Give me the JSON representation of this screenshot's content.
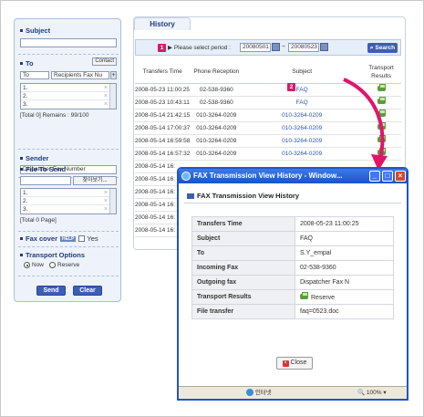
{
  "left_panel": {
    "subject_label": "Subject",
    "to_label": "To",
    "contact_button": "Contact",
    "to_type_value": "To",
    "recipients_fax_placeholder": "Recipients Fax Nu",
    "recipient_rows": [
      "1.",
      "2.",
      "3."
    ],
    "to_total": "[Total 0] Remains : 99/100",
    "sender_label": "Sender",
    "sender_value": "Dispatcher Fax Number",
    "file_label": "File To Send",
    "browse_button": "찾아보기...",
    "file_rows": [
      "1.",
      "2.",
      "3."
    ],
    "file_total": "[Total 0 Page]",
    "fax_cover_label": "Fax cover",
    "help_label": "HELP",
    "fax_cover_yes": "Yes",
    "transport_label": "Transport Options",
    "transport_now": "Now",
    "transport_reserve": "Reserve",
    "send_button": "Send",
    "clear_button": "Clear"
  },
  "history": {
    "tab_label": "History",
    "badge1": "1",
    "period_label": "Please select period :",
    "date_from": "20080501",
    "date_sep": "~",
    "date_to": "20080523",
    "search_button": "Search",
    "badge2": "2",
    "columns": [
      "Transfers Time",
      "Phone Reception",
      "Subject",
      "Transport Results"
    ],
    "rows": [
      {
        "time": "2008-05-23 11:00:25",
        "phone": "02-538-9360",
        "subject": "FAQ"
      },
      {
        "time": "2008-05-23 10:43:11",
        "phone": "02-538-9360",
        "subject": "FAQ"
      },
      {
        "time": "2008-05-14 21:42:15",
        "phone": "010-3264-0209",
        "subject": "010-3264-0209"
      },
      {
        "time": "2008-05-14 17:00:37",
        "phone": "010-3264-0209",
        "subject": "010-3264-0209"
      },
      {
        "time": "2008-05-14 16:59:58",
        "phone": "010-3264-0209",
        "subject": "010-3264-0209"
      },
      {
        "time": "2008-05-14 16:57:32",
        "phone": "010-3264-0209",
        "subject": "010-3264-0209"
      },
      {
        "time": "2008-05-14 16:",
        "phone": "",
        "subject": ""
      },
      {
        "time": "2008-05-14 16:",
        "phone": "",
        "subject": ""
      },
      {
        "time": "2008-05-14 16:",
        "phone": "",
        "subject": ""
      },
      {
        "time": "2008-05-14 16:",
        "phone": "",
        "subject": ""
      },
      {
        "time": "2008-05-14 16:",
        "phone": "",
        "subject": ""
      },
      {
        "time": "2008-05-14 16:",
        "phone": "",
        "subject": ""
      }
    ]
  },
  "popup": {
    "window_title": "FAX Transmission View History - Window...",
    "header": "FAX Transmission View History",
    "details": [
      {
        "key": "Transfers Time",
        "value": "2008-05-23 11:00:25"
      },
      {
        "key": "Subject",
        "value": "FAQ"
      },
      {
        "key": "To",
        "value": "S.Y_empal"
      },
      {
        "key": "Incoming Fax",
        "value": "02-538-9360"
      },
      {
        "key": "Outgoing fax",
        "value": "Dispatcher Fax N"
      },
      {
        "key": "Transport Results",
        "value": "Reserve"
      },
      {
        "key": "File transfer",
        "value": "faq=0523.doc"
      }
    ],
    "close_button": "Close",
    "status_zone": "인터넷",
    "zoom": "100%"
  },
  "colors": {
    "accent": "#3c5fb4",
    "badge": "#d41c69",
    "titlebar": "#1e52c6"
  }
}
